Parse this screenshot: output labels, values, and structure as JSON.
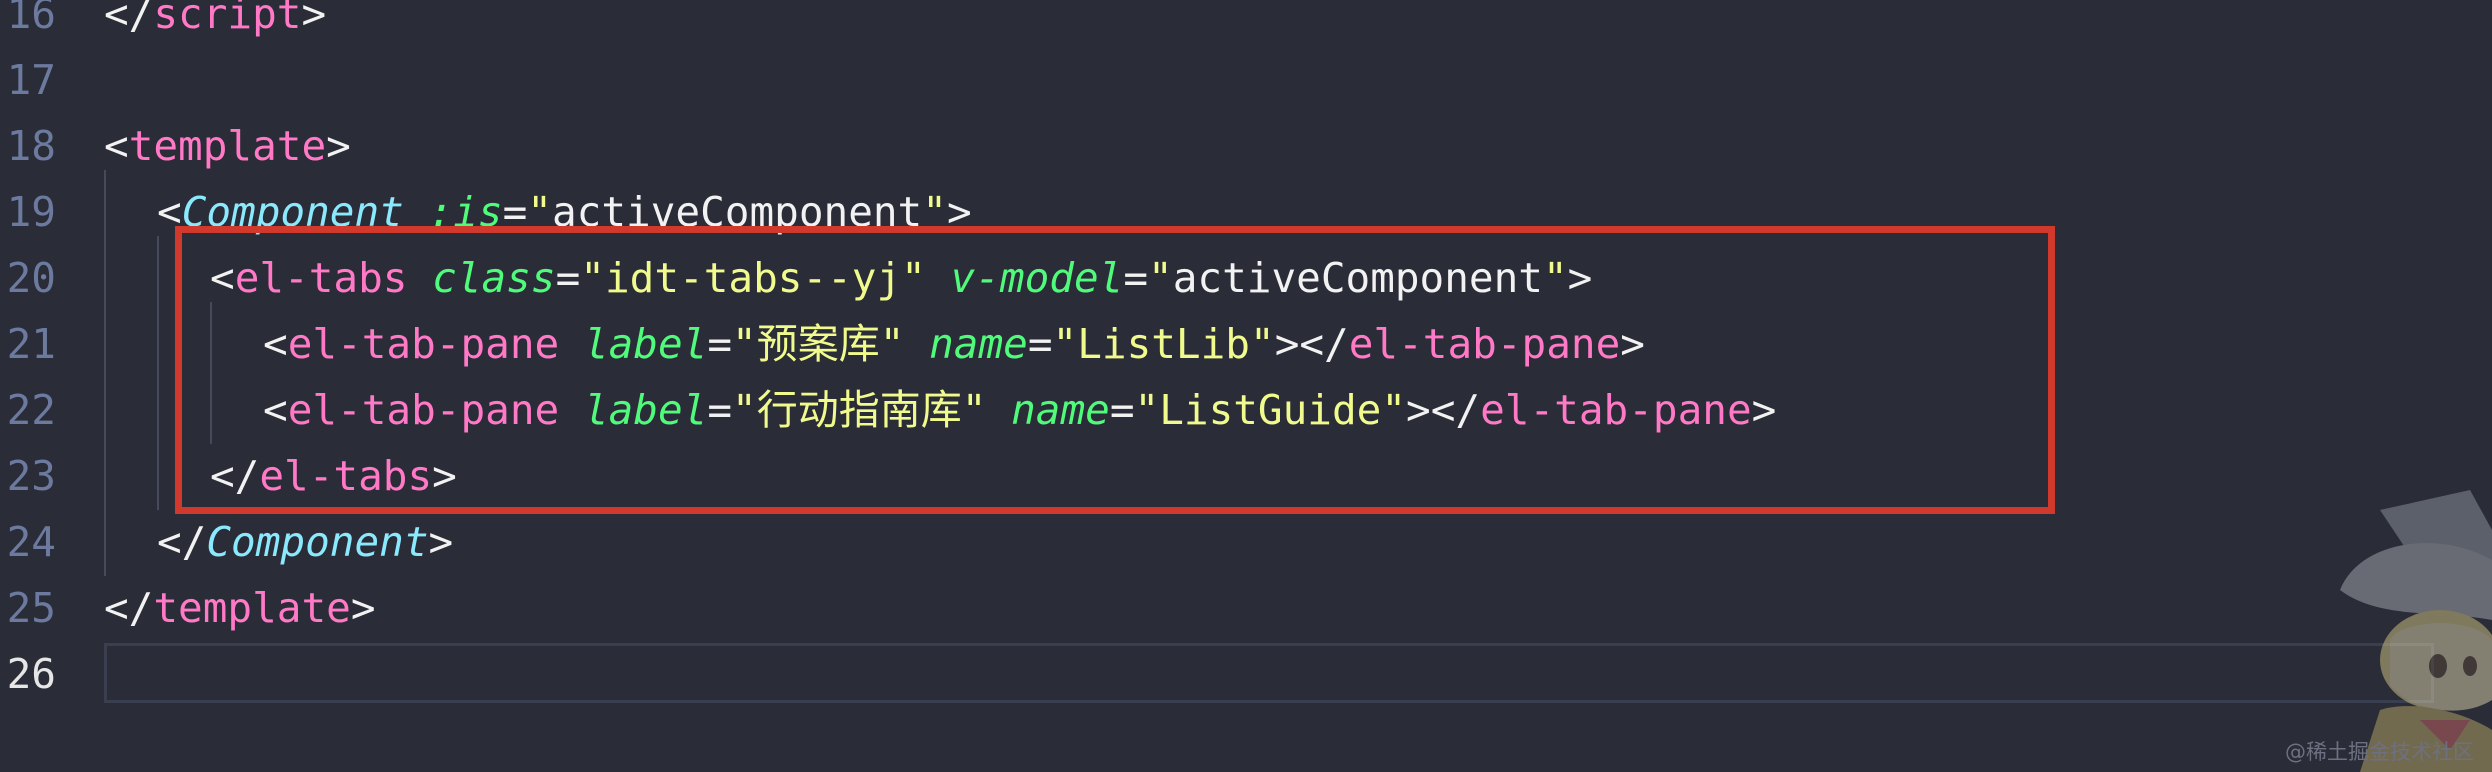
{
  "editor": {
    "lines": [
      {
        "num": "16",
        "segments": [
          [
            "punct",
            "</"
          ],
          [
            "tag",
            "script"
          ],
          [
            "punct",
            ">"
          ]
        ]
      },
      {
        "num": "17",
        "segments": []
      },
      {
        "num": "18",
        "segments": [
          [
            "punct",
            "<"
          ],
          [
            "tag",
            "template"
          ],
          [
            "punct",
            ">"
          ]
        ]
      },
      {
        "num": "19",
        "segments": [
          [
            "punct",
            "<"
          ],
          [
            "comp",
            "Component"
          ],
          [
            "punct",
            " "
          ],
          [
            "attr",
            ":is"
          ],
          [
            "eq",
            "="
          ],
          [
            "str",
            "\""
          ],
          [
            "punct",
            "activeComponent"
          ],
          [
            "str",
            "\""
          ],
          [
            "punct",
            ">"
          ]
        ]
      },
      {
        "num": "20",
        "segments": [
          [
            "punct",
            "<"
          ],
          [
            "tag",
            "el-tabs"
          ],
          [
            "punct",
            " "
          ],
          [
            "attr",
            "class"
          ],
          [
            "eq",
            "="
          ],
          [
            "str",
            "\"idt-tabs--yj\""
          ],
          [
            "punct",
            " "
          ],
          [
            "attr",
            "v-model"
          ],
          [
            "eq",
            "="
          ],
          [
            "str",
            "\""
          ],
          [
            "punct",
            "activeComponent"
          ],
          [
            "str",
            "\""
          ],
          [
            "punct",
            ">"
          ]
        ]
      },
      {
        "num": "21",
        "segments": [
          [
            "punct",
            "<"
          ],
          [
            "tag",
            "el-tab-pane"
          ],
          [
            "punct",
            " "
          ],
          [
            "attr",
            "label"
          ],
          [
            "eq",
            "="
          ],
          [
            "str",
            "\"预案库\""
          ],
          [
            "punct",
            " "
          ],
          [
            "attr",
            "name"
          ],
          [
            "eq",
            "="
          ],
          [
            "str",
            "\"ListLib\""
          ],
          [
            "punct",
            "></"
          ],
          [
            "tag",
            "el-tab-pane"
          ],
          [
            "punct",
            ">"
          ]
        ]
      },
      {
        "num": "22",
        "segments": [
          [
            "punct",
            "<"
          ],
          [
            "tag",
            "el-tab-pane"
          ],
          [
            "punct",
            " "
          ],
          [
            "attr",
            "label"
          ],
          [
            "eq",
            "="
          ],
          [
            "str",
            "\"行动指南库\""
          ],
          [
            "punct",
            " "
          ],
          [
            "attr",
            "name"
          ],
          [
            "eq",
            "="
          ],
          [
            "str",
            "\"ListGuide\""
          ],
          [
            "punct",
            "></"
          ],
          [
            "tag",
            "el-tab-pane"
          ],
          [
            "punct",
            ">"
          ]
        ]
      },
      {
        "num": "23",
        "segments": [
          [
            "punct",
            "</"
          ],
          [
            "tag",
            "el-tabs"
          ],
          [
            "punct",
            ">"
          ]
        ]
      },
      {
        "num": "24",
        "segments": [
          [
            "punct",
            "</"
          ],
          [
            "comp",
            "Component"
          ],
          [
            "punct",
            ">"
          ]
        ]
      },
      {
        "num": "25",
        "segments": [
          [
            "punct",
            "</"
          ],
          [
            "tag",
            "template"
          ],
          [
            "punct",
            ">"
          ]
        ]
      },
      {
        "num": "26",
        "segments": []
      }
    ]
  },
  "watermark": "@稀土掘金技术社区",
  "colors": {
    "background": "#2a2c37",
    "line_number": "#6b7a9e",
    "tag": "#ff79c6",
    "component": "#8be9fd",
    "attribute": "#50fa7b",
    "string": "#f1fa8c",
    "highlight_box": "#d0392b"
  },
  "icons": {
    "mascot": "witch-mascot-icon"
  }
}
